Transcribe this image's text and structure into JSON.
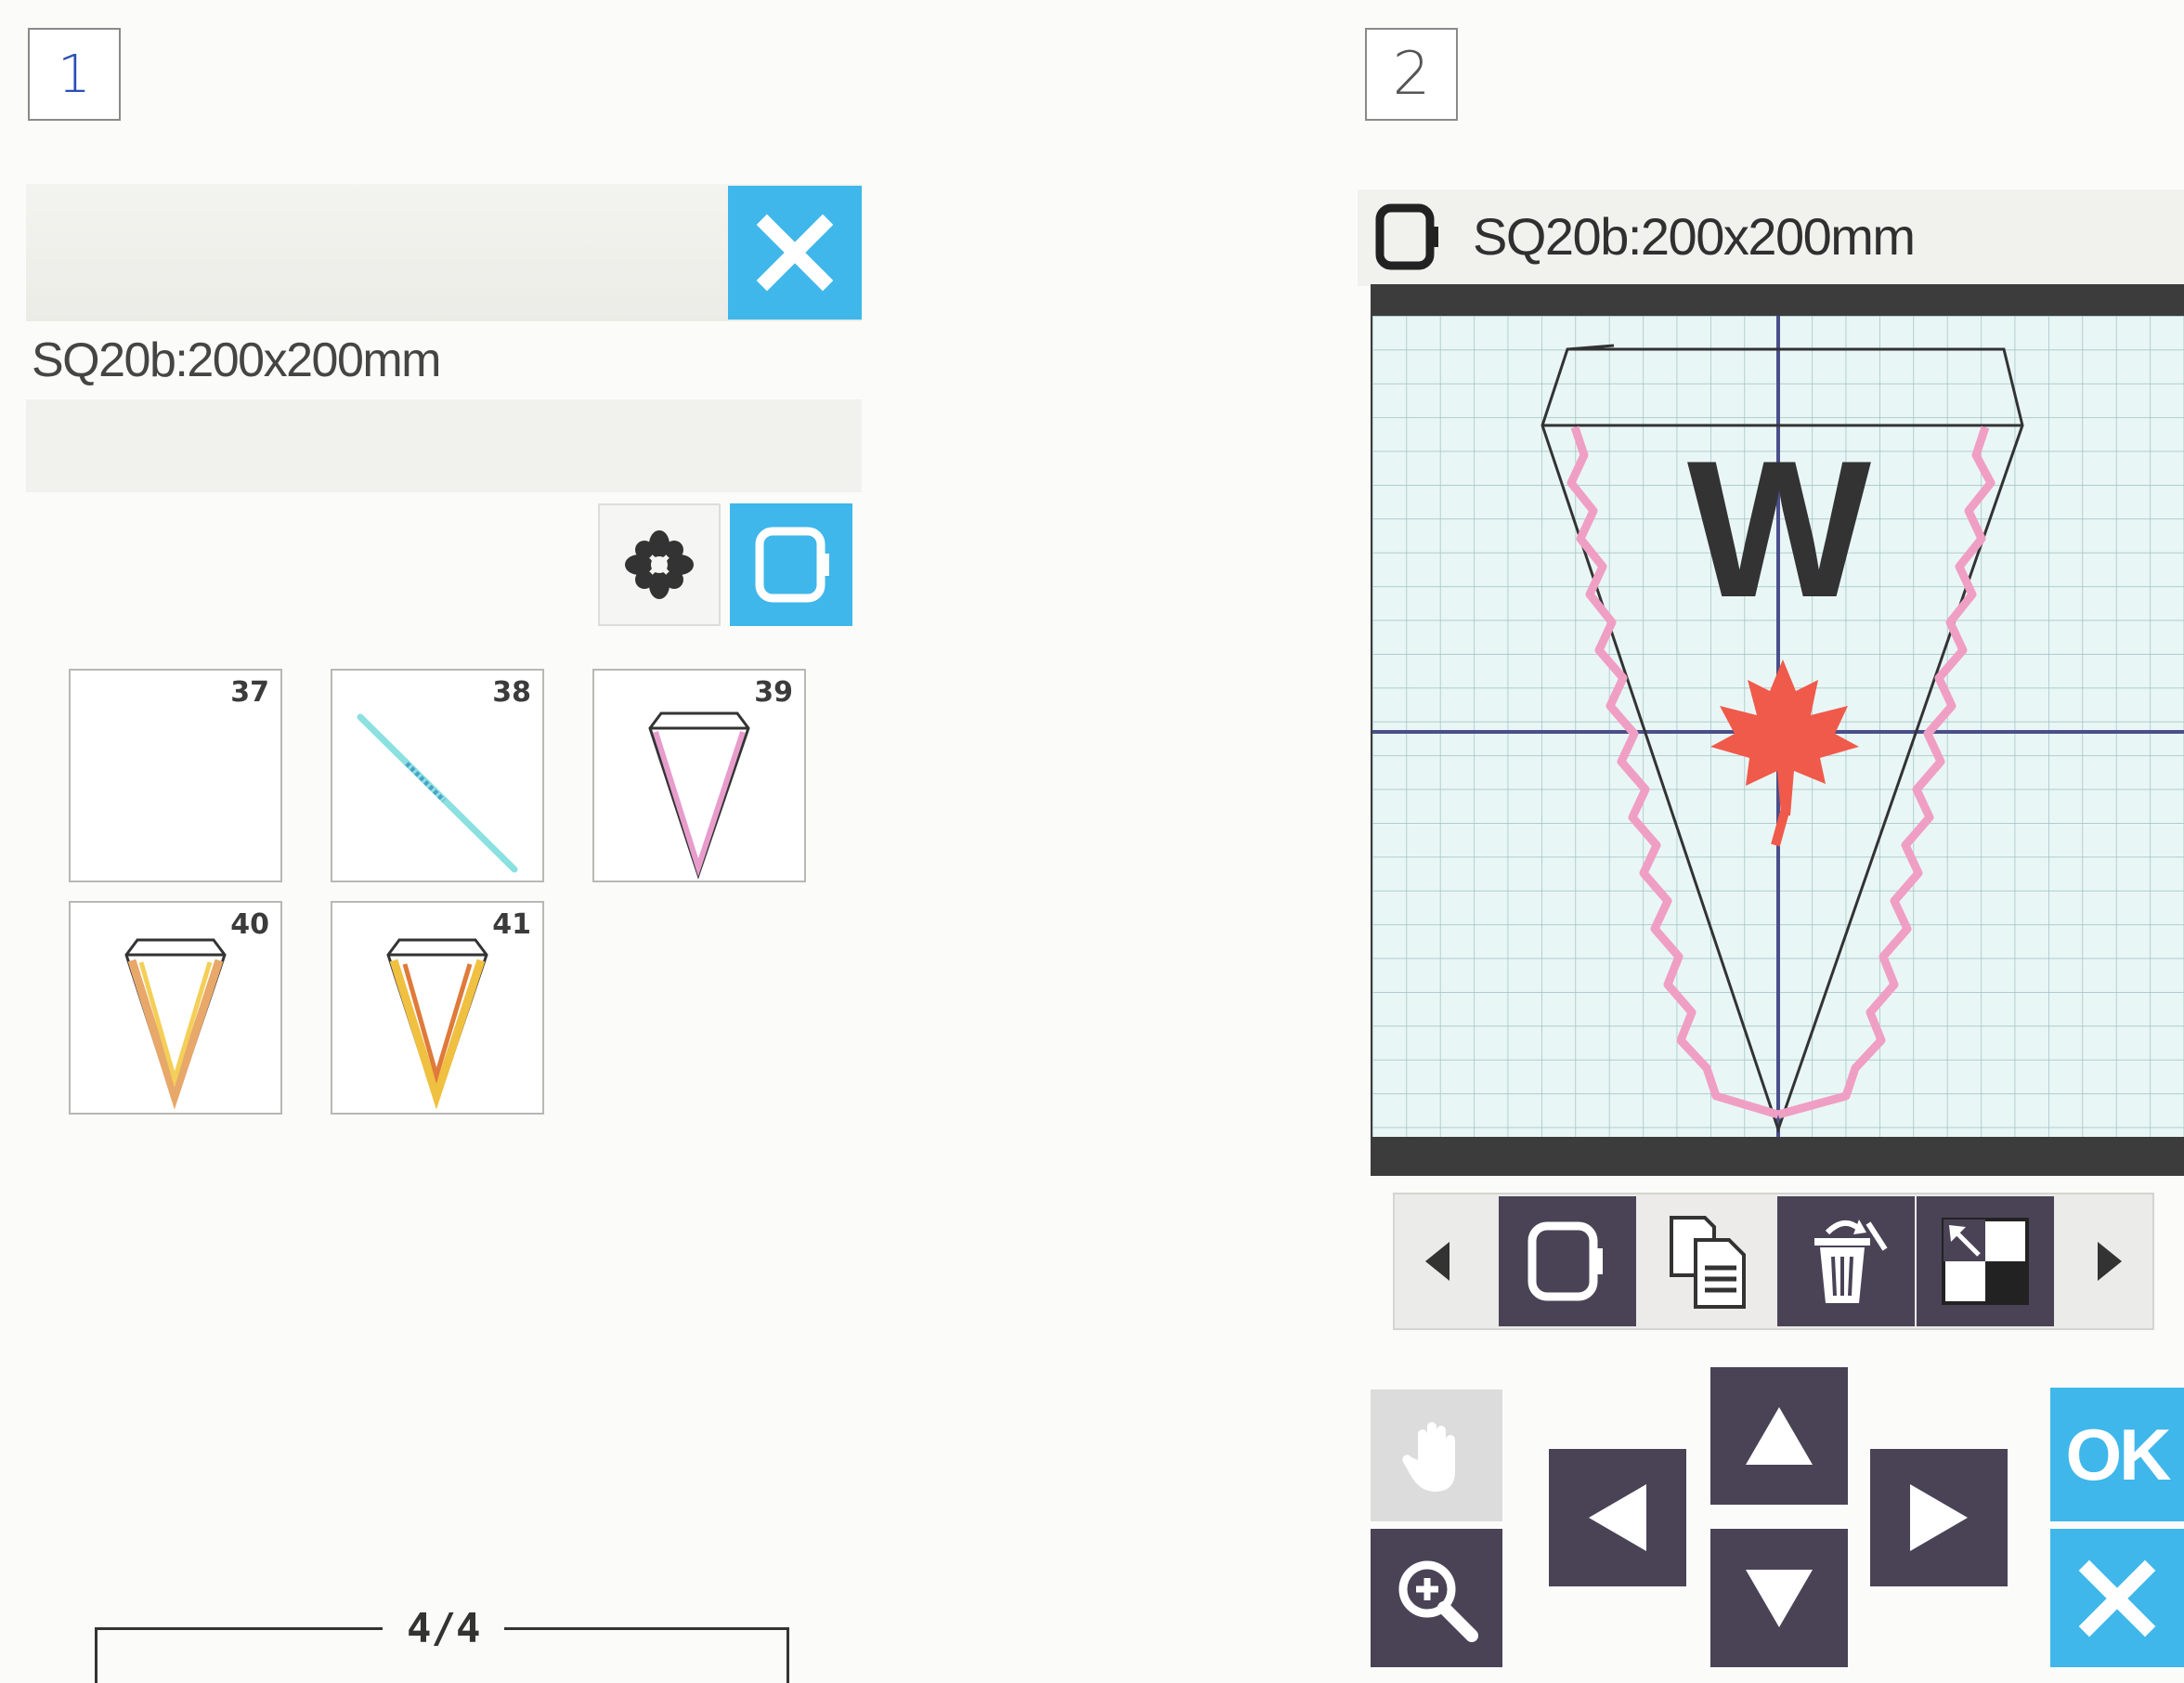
{
  "step1": {
    "label": "1"
  },
  "step2": {
    "label": "2"
  },
  "panel1": {
    "hoop_name": "SQ20b:200x200mm",
    "thumbnails": [
      {
        "number": "37",
        "design": "blank"
      },
      {
        "number": "38",
        "design": "diagonal-line"
      },
      {
        "number": "39",
        "design": "pennant-pink"
      },
      {
        "number": "40",
        "design": "pennant-orange"
      },
      {
        "number": "41",
        "design": "pennant-yellow"
      }
    ],
    "page_indicator": "4/4",
    "icons": [
      "close-icon",
      "flower-icon",
      "hoop-icon"
    ],
    "accent_color": "#3fb7ea"
  },
  "panel2": {
    "hoop_name": "SQ20b:200x200mm",
    "design_letter": "W",
    "toolbar_icons": [
      "hoop-icon",
      "copy-icon",
      "delete-icon",
      "resize-icon"
    ],
    "ok_label": "OK",
    "leaf_color": "#f05a4a",
    "ric_rac_color": "#f09fc4"
  }
}
